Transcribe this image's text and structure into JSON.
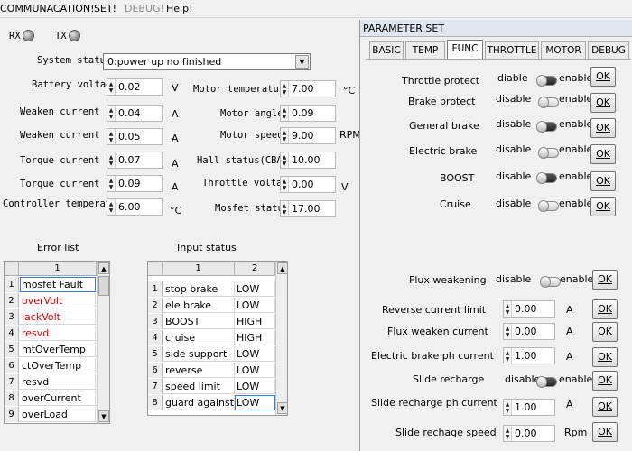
{
  "menu": [
    {
      "label": "COMMUNACATION!",
      "disabled": false
    },
    {
      "label": "SET!",
      "disabled": false
    },
    {
      "label": "DEBUG!",
      "disabled": true
    },
    {
      "label": "Help!",
      "disabled": false
    }
  ],
  "leds": {
    "rx": "RX",
    "tx": "TX"
  },
  "system_status": {
    "label": "System status",
    "value": "0:power up no finished"
  },
  "left_fields": [
    {
      "label": "Battery voltage",
      "value": "0.02",
      "unit": "V"
    },
    {
      "label": "Weaken current cmd",
      "value": "0.04",
      "unit": "A"
    },
    {
      "label": "Weaken current fdk",
      "value": "0.05",
      "unit": "A"
    },
    {
      "label": "Torque current cmd",
      "value": "0.07",
      "unit": "A"
    },
    {
      "label": "Torque current fbk",
      "value": "0.09",
      "unit": "A"
    },
    {
      "label": "Controller temperature",
      "value": "6.00",
      "unit": "°C"
    }
  ],
  "right_fields": [
    {
      "label": "Motor temperature",
      "value": "7.00",
      "unit": "°C"
    },
    {
      "label": "Motor angle",
      "value": "0.09",
      "unit": ""
    },
    {
      "label": "Motor speed",
      "value": "9.00",
      "unit": "RPM"
    },
    {
      "label": "Hall status(CBA)",
      "value": "10.00",
      "unit": ""
    },
    {
      "label": "Throttle voltage",
      "value": "0.00",
      "unit": "V"
    },
    {
      "label": "Mosfet status",
      "value": "17.00",
      "unit": ""
    }
  ],
  "error_list": {
    "title": "Error list",
    "header": "1",
    "rows": [
      {
        "n": "1",
        "text": "mosfet Fault",
        "red": false
      },
      {
        "n": "2",
        "text": "overVolt",
        "red": true
      },
      {
        "n": "3",
        "text": "lackVolt",
        "red": true
      },
      {
        "n": "4",
        "text": "resvd",
        "red": true
      },
      {
        "n": "5",
        "text": "mtOverTemp",
        "red": false
      },
      {
        "n": "6",
        "text": "ctOverTemp",
        "red": false
      },
      {
        "n": "7",
        "text": "resvd",
        "red": false
      },
      {
        "n": "8",
        "text": "overCurrent",
        "red": false
      },
      {
        "n": "9",
        "text": "overLoad",
        "red": false
      }
    ]
  },
  "input_status": {
    "title": "Input status",
    "headers": [
      "1",
      "2"
    ],
    "rows": [
      {
        "n": "1",
        "name": "stop brake",
        "state": "LOW"
      },
      {
        "n": "2",
        "name": "ele brake",
        "state": "LOW"
      },
      {
        "n": "3",
        "name": "BOOST",
        "state": "HIGH"
      },
      {
        "n": "4",
        "name": "cruise",
        "state": "HIGH"
      },
      {
        "n": "5",
        "name": "side support",
        "state": "LOW"
      },
      {
        "n": "6",
        "name": "reverse",
        "state": "LOW"
      },
      {
        "n": "7",
        "name": "speed limit",
        "state": "LOW"
      },
      {
        "n": "8",
        "name": "guard against",
        "state": "LOW"
      }
    ]
  },
  "param_panel": {
    "title": "PARAMETER SET",
    "tabs": [
      "BASIC",
      "TEMP",
      "FUNC",
      "THROTTLE",
      "MOTOR",
      "DEBUG"
    ],
    "active_tab": "FUNC",
    "ok_label": "OK",
    "toggles": [
      {
        "label": "Throttle protect",
        "off": "diable",
        "on": "enable",
        "state": "on"
      },
      {
        "label": "Brake protect",
        "off": "disable",
        "on": "enable",
        "state": "off"
      },
      {
        "label": "General brake",
        "off": "disable",
        "on": "enable",
        "state": "on"
      },
      {
        "label": "Electric brake",
        "off": "disable",
        "on": "enable",
        "state": "off"
      },
      {
        "label": "BOOST",
        "off": "disable",
        "on": "enable",
        "state": "on"
      },
      {
        "label": "Cruise",
        "off": "disable",
        "on": "enable",
        "state": "off"
      }
    ],
    "flux": {
      "label": "Flux weakening",
      "off": "disable",
      "on": "enable",
      "state": "off"
    },
    "slide": {
      "label": "Slide recharge",
      "off": "disable",
      "on": "enable",
      "state": "on"
    },
    "numeric": [
      {
        "label": "Reverse current limit",
        "value": "0.00",
        "unit": "A"
      },
      {
        "label": "Flux weaken current",
        "value": "0.00",
        "unit": "A"
      },
      {
        "label": "Electric brake ph current",
        "value": "1.00",
        "unit": "A"
      },
      {
        "label": "Slide recharge ph current",
        "value": "1.00",
        "unit": "A"
      },
      {
        "label": "Slide rechage speed",
        "value": "0.00",
        "unit": "Rpm"
      }
    ]
  }
}
